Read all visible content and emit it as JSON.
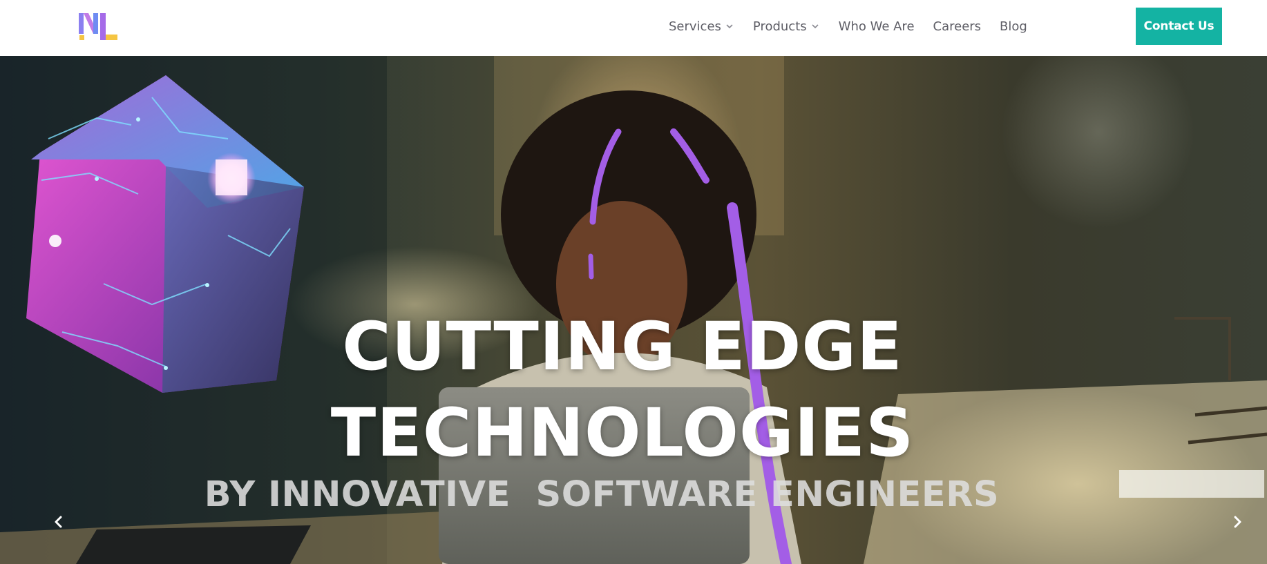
{
  "nav": {
    "items": [
      {
        "label": "Services",
        "has_dropdown": true
      },
      {
        "label": "Products",
        "has_dropdown": true
      },
      {
        "label": "Who We Are",
        "has_dropdown": false
      },
      {
        "label": "Careers",
        "has_dropdown": false
      },
      {
        "label": "Blog",
        "has_dropdown": false
      }
    ],
    "contact_label": "Contact Us"
  },
  "hero": {
    "title_line1": "CUTTING EDGE",
    "title_line2": "TECHNOLOGIES",
    "subtitle": "BY INNOVATIVE  SOFTWARE ENGINEERS",
    "prev_icon": "chevron-left-icon",
    "next_icon": "chevron-right-icon"
  },
  "colors": {
    "accent": "#14b3a3",
    "nav_text": "#5e5e66",
    "purple": "#a35ee6",
    "logo_yellow": "#f5c542"
  }
}
